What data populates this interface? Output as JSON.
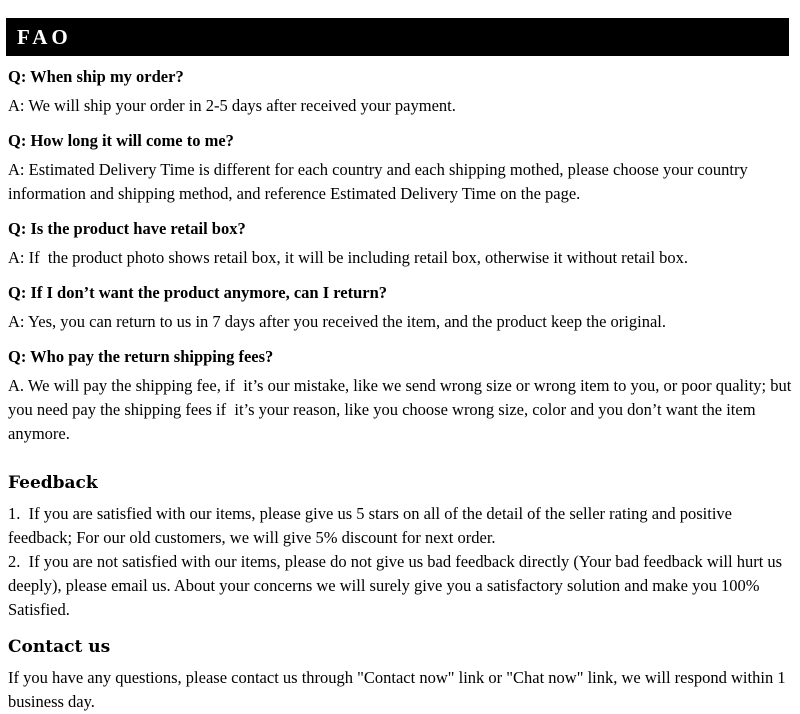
{
  "header": {
    "title": "FAO"
  },
  "faq": {
    "items": [
      {
        "question": "Q: When ship my order?",
        "answer": "A: We will ship your order in 2-5 days after received your payment."
      },
      {
        "question": "Q: How long it will come to me?",
        "answer": "A: Estimated Delivery Time is different for each country and each shipping mothed, please choose your country information and shipping method, and reference Estimated Delivery Time on the page."
      },
      {
        "question": "Q: Is the product have retail box?",
        "answer": "A: If  the product photo shows retail box, it will be including retail box, otherwise it without retail box."
      },
      {
        "question": "Q: If I don’t want the product anymore, can I return?",
        "answer": "A: Yes, you can return to us in 7 days after you received the item, and the product keep the original."
      },
      {
        "question": "Q: Who pay the return shipping fees?",
        "answer": "A. We will pay the shipping fee, if  it’s our mistake, like we send wrong size or wrong item to you, or poor quality; but you need pay the shipping fees if  it’s your reason, like you choose wrong size, color and you don’t want the item anymore."
      }
    ]
  },
  "feedback": {
    "heading": "Feedback",
    "paragraphs": [
      "1.  If you are satisfied with our items, please give us 5 stars on all of the detail of the seller rating and positive feedback; For our old customers, we will give 5% discount for next order.",
      "2.  If you are not satisfied with our items, please do not give us bad feedback directly (Your bad feedback will hurt us deeply), please email us. About your concerns we will surely give you a satisfactory solution and make you 100% Satisfied."
    ]
  },
  "contact": {
    "heading": "Contact us",
    "paragraphs": [
      "If you have any questions, please contact us through \"Contact now\" link or \"Chat now\" link, we will respond within 1 business day."
    ]
  },
  "colors": {
    "header_background": "#000000",
    "header_text": "#ffffff",
    "page_background": "#ffffff",
    "body_text": "#000000"
  }
}
